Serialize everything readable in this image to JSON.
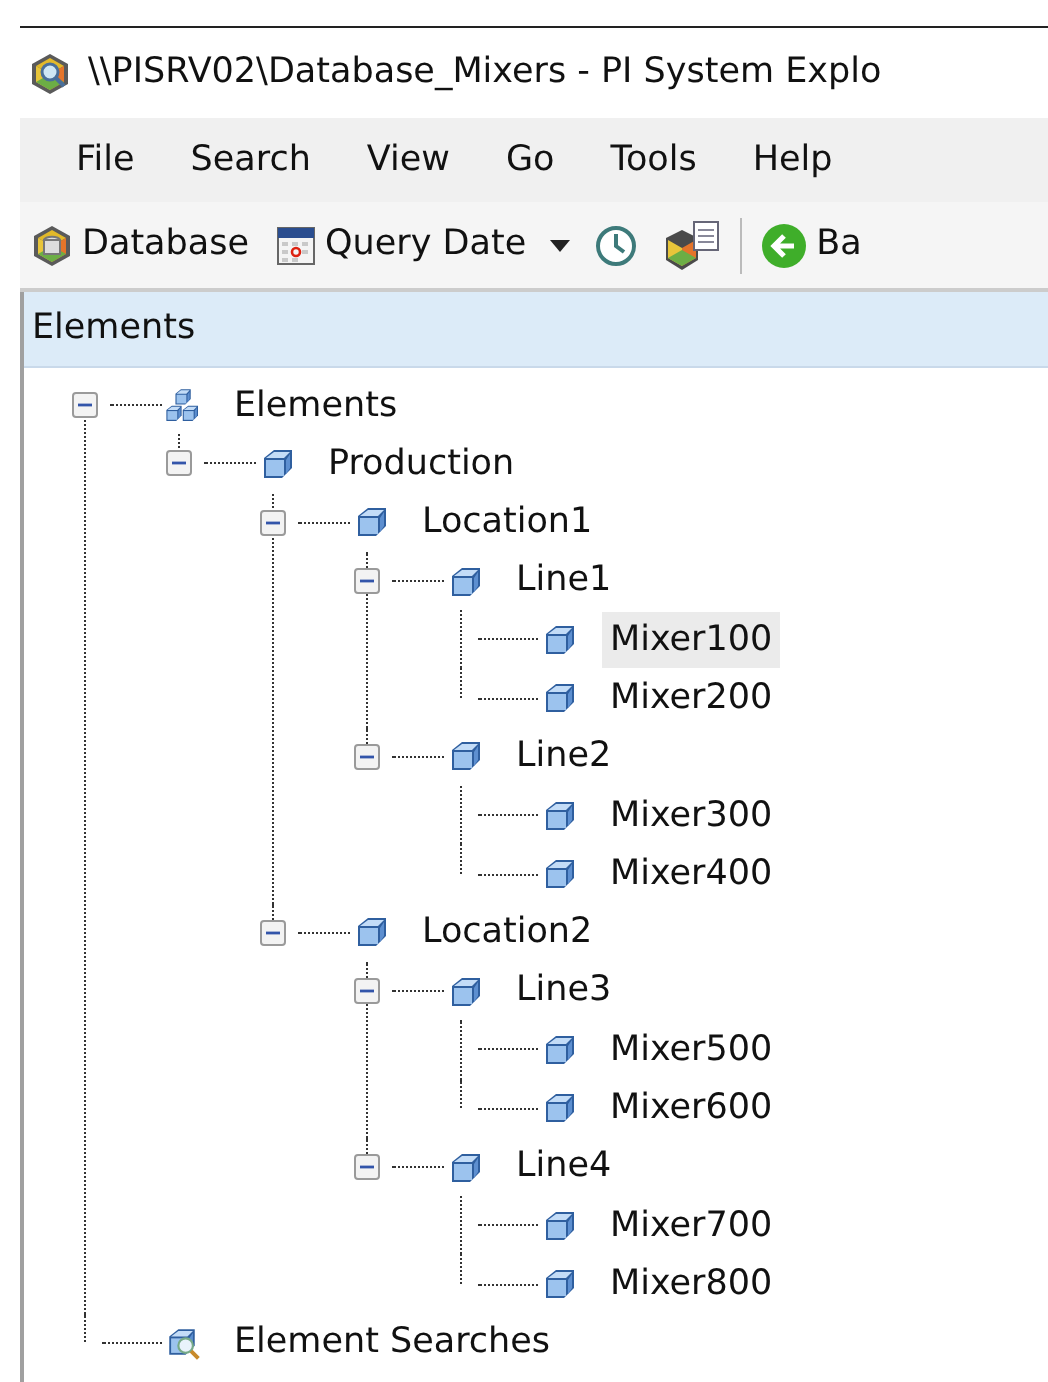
{
  "window": {
    "title": "\\\\PISRV02\\Database_Mixers - PI System Explo"
  },
  "menu": [
    {
      "label": "File"
    },
    {
      "label": "Search"
    },
    {
      "label": "View"
    },
    {
      "label": "Go"
    },
    {
      "label": "Tools"
    },
    {
      "label": "Help"
    }
  ],
  "toolbar": [
    {
      "kind": "database",
      "label": "Database"
    },
    {
      "kind": "calendar",
      "label": "Query Date"
    },
    {
      "kind": "dropdown"
    },
    {
      "kind": "clock"
    },
    {
      "kind": "database-document"
    },
    {
      "kind": "separator"
    },
    {
      "kind": "back",
      "label": "Ba"
    }
  ],
  "panel": {
    "title": "Elements",
    "tree": [
      {
        "kind": "root",
        "label": "Elements",
        "expanded": true,
        "selected": false,
        "children": [
          {
            "kind": "element",
            "label": "Production",
            "expanded": true,
            "selected": false,
            "children": [
              {
                "kind": "element",
                "label": "Location1",
                "expanded": true,
                "selected": false,
                "children": [
                  {
                    "kind": "element",
                    "label": "Line1",
                    "expanded": true,
                    "selected": false,
                    "children": [
                      {
                        "kind": "leaf",
                        "label": "Mixer100",
                        "selected": true
                      },
                      {
                        "kind": "leaf",
                        "label": "Mixer200",
                        "selected": false
                      }
                    ]
                  },
                  {
                    "kind": "element",
                    "label": "Line2",
                    "expanded": true,
                    "selected": false,
                    "children": [
                      {
                        "kind": "leaf",
                        "label": "Mixer300",
                        "selected": false
                      },
                      {
                        "kind": "leaf",
                        "label": "Mixer400",
                        "selected": false
                      }
                    ]
                  }
                ]
              },
              {
                "kind": "element",
                "label": "Location2",
                "expanded": true,
                "selected": false,
                "children": [
                  {
                    "kind": "element",
                    "label": "Line3",
                    "expanded": true,
                    "selected": false,
                    "children": [
                      {
                        "kind": "leaf",
                        "label": "Mixer500",
                        "selected": false
                      },
                      {
                        "kind": "leaf",
                        "label": "Mixer600",
                        "selected": false
                      }
                    ]
                  },
                  {
                    "kind": "element",
                    "label": "Line4",
                    "expanded": true,
                    "selected": false,
                    "children": [
                      {
                        "kind": "leaf",
                        "label": "Mixer700",
                        "selected": false
                      },
                      {
                        "kind": "leaf",
                        "label": "Mixer800",
                        "selected": false
                      }
                    ]
                  }
                ]
              }
            ]
          }
        ]
      },
      {
        "kind": "search",
        "label": "Element Searches",
        "selected": false
      }
    ]
  }
}
